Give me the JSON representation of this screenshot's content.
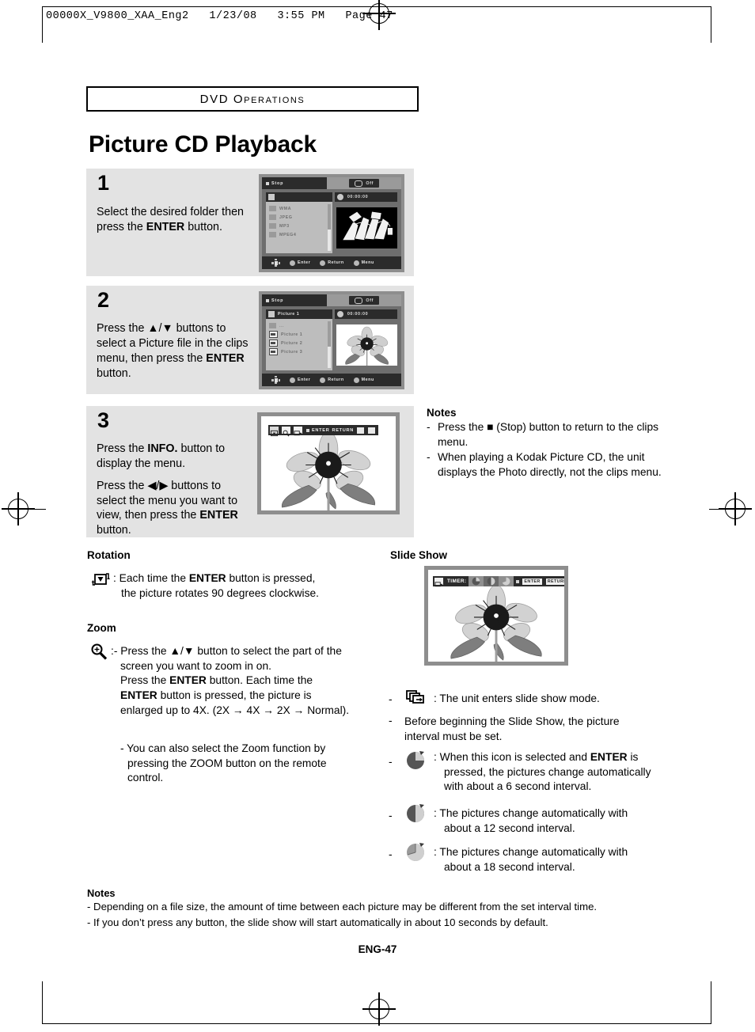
{
  "print_header": "00000X_V9800_XAA_Eng2   1/23/08   3:55 PM   Page 47",
  "section_chip": "DVD Operations",
  "page_title": "Picture CD Playback",
  "steps": [
    {
      "number": "1",
      "lines": [
        "Select the desired folder then press the ENTER button."
      ],
      "bold_terms": [
        "ENTER"
      ]
    },
    {
      "number": "2",
      "lines": [
        "Press the ▲/▼ buttons to select a Picture file in the clips menu, then press the ENTER button."
      ],
      "bold_terms": [
        "ENTER"
      ]
    },
    {
      "number": "3",
      "lines": [
        "Press the INFO. button to display the menu.",
        "Press the ◀/▶ buttons to select the menu you want to view, then press the ENTER button."
      ],
      "bold_terms": [
        "INFO.",
        "ENTER"
      ]
    }
  ],
  "osd_screen_1": {
    "status": "Stop",
    "repeat_label": "Off",
    "file_title": "",
    "time": "00:00:00",
    "files": [
      "WMA",
      "JPEG",
      "MP3",
      "MPEG4"
    ],
    "bottom": {
      "enter": "Enter",
      "return": "Return",
      "menu": "Menu"
    }
  },
  "osd_screen_2": {
    "status": "Stop",
    "repeat_label": "Off",
    "file_title": "Picture 1",
    "time": "00:00:00",
    "parent_dir": "...",
    "files": [
      "Picture 1",
      "Picture 2",
      "Picture 3"
    ],
    "bottom": {
      "enter": "Enter",
      "return": "Return",
      "menu": "Menu"
    }
  },
  "osd_screen_3": {
    "icons": [
      "rotate-icon",
      "zoom-icon",
      "slideshow-icon"
    ],
    "enter": "ENTER",
    "return": "RETURN"
  },
  "osd_slideshow": {
    "timer_label": "TIMER:",
    "enter": "ENTER",
    "return": "RETURN",
    "intervals": [
      "6s",
      "12s",
      "18s"
    ]
  },
  "notes_step3": {
    "title": "Notes",
    "items": [
      "Press the ■ (Stop) button to return to the clips menu.",
      "When playing a Kodak Picture CD, the unit displays the Photo directly, not the clips menu."
    ]
  },
  "rotation": {
    "title": "Rotation",
    "icon": "rotate-icon",
    "text_line1": ": Each time the ENTER button is pressed,",
    "text_line2": "the picture rotates 90 degrees clockwise."
  },
  "zoom_section": {
    "title": "Zoom",
    "icon": "magnifier-plus-icon",
    "lines": [
      ":- Press the ▲/▼  button to select the part of the",
      "screen you want to zoom in on.",
      "Press the ENTER button. Each time the",
      "ENTER button is pressed, the picture is",
      "enlarged up to 4X. (2X → 4X → 2X → Normal)."
    ],
    "sub_note": [
      "- You can also select the Zoom function by",
      "pressing the ZOOM button on the remote",
      "control."
    ]
  },
  "slide_show": {
    "title": "Slide Show",
    "items": [
      {
        "icon": "slideshow-icon",
        "text": ": The unit enters slide show mode."
      },
      {
        "icon": null,
        "text": "Before beginning the Slide Show, the picture interval must be set."
      },
      {
        "icon": "pie-6s-icon",
        "text": ": When this icon is selected and ENTER is pressed, the pictures change automatically with about a 6 second interval."
      },
      {
        "icon": "pie-12s-icon",
        "text": ": The pictures change automatically with about a 12 second interval."
      },
      {
        "icon": "pie-18s-icon",
        "text": ": The pictures change automatically with about a 18 second interval."
      }
    ]
  },
  "notes_bottom": {
    "title": "Notes",
    "items": [
      "- Depending on a file size, the amount of time between each picture may be different from the set interval time.",
      "- If you don’t press any button, the slide show will start automatically in about 10 seconds by default."
    ]
  },
  "footer": "ENG-47"
}
